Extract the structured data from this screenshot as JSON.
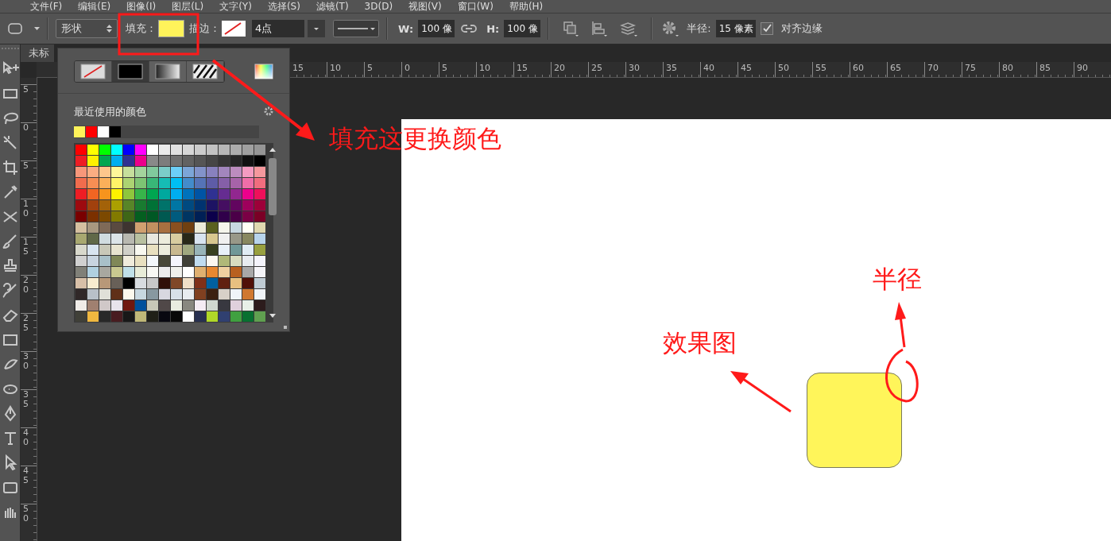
{
  "menu": [
    "文件(F)",
    "编辑(E)",
    "图像(I)",
    "图层(L)",
    "文字(Y)",
    "选择(S)",
    "滤镜(T)",
    "3D(D)",
    "视图(V)",
    "窗口(W)",
    "帮助(H)"
  ],
  "options_bar": {
    "mode": "形状",
    "fill_label": "填充：",
    "fill": {
      "color": "#fff35a"
    },
    "stroke_label": "描边：",
    "stroke_width": "4点",
    "w_label": "W:",
    "w_value": "100 像",
    "h_label": "H:",
    "h_value": "100 像",
    "radius_label": "半径:",
    "radius_value": "15 像素",
    "align_edges": {
      "label": "对齐边缘",
      "checked": true
    }
  },
  "document_tab": "未标",
  "ruler": {
    "h_labels": [
      "15",
      "10",
      "5",
      "0",
      "5",
      "10",
      "15",
      "20",
      "25",
      "30",
      "35",
      "40",
      "45",
      "50",
      "55",
      "60",
      "65",
      "70",
      "75",
      "80",
      "85",
      "90"
    ],
    "v_labels": [
      "5",
      "0",
      "5",
      "10",
      "15",
      "20",
      "25",
      "30",
      "35",
      "40",
      "45",
      "50"
    ]
  },
  "fill_popover": {
    "types": [
      {
        "kind": "none",
        "selected": false
      },
      {
        "kind": "solid",
        "selected": true
      },
      {
        "kind": "gradient",
        "selected": false
      },
      {
        "kind": "pattern",
        "selected": false
      }
    ],
    "recent_label": "最近使用的颜色",
    "recent_colors": [
      {
        "color": "#fff35a"
      },
      {
        "color": "#ff0000"
      },
      {
        "color": "#ffffff"
      },
      {
        "color": "#000000"
      }
    ],
    "swatch_rows": [
      [
        {
          "color": "#ff0000"
        },
        {
          "color": "#ffff00"
        },
        {
          "color": "#00ff00"
        },
        {
          "color": "#00ffff"
        },
        {
          "color": "#0000ff"
        },
        {
          "color": "#ff00ff"
        },
        {
          "color": "#ffffff"
        },
        {
          "color": "#ebebeb"
        },
        {
          "color": "#e1e1e1"
        },
        {
          "color": "#d7d7d7"
        },
        {
          "color": "#cccccc"
        },
        {
          "color": "#c2c2c2"
        },
        {
          "color": "#b7b7b7"
        },
        {
          "color": "#acacac"
        },
        {
          "color": "#a0a0a0"
        },
        {
          "color": "#959595"
        }
      ],
      [
        {
          "color": "#ee1d24"
        },
        {
          "color": "#fff100"
        },
        {
          "color": "#00a650"
        },
        {
          "color": "#00aeef"
        },
        {
          "color": "#2f3192"
        },
        {
          "color": "#ed008c"
        },
        {
          "color": "#898989"
        },
        {
          "color": "#7d7d7d"
        },
        {
          "color": "#707070"
        },
        {
          "color": "#626262"
        },
        {
          "color": "#555555"
        },
        {
          "color": "#464646"
        },
        {
          "color": "#363636"
        },
        {
          "color": "#262626"
        },
        {
          "color": "#111111"
        },
        {
          "color": "#000000"
        }
      ],
      [
        {
          "color": "#f7977a"
        },
        {
          "color": "#fbad82"
        },
        {
          "color": "#fdc68c"
        },
        {
          "color": "#fff799"
        },
        {
          "color": "#c6df9c"
        },
        {
          "color": "#a4d49d"
        },
        {
          "color": "#81ca9d"
        },
        {
          "color": "#7bcdc9"
        },
        {
          "color": "#6ccff7"
        },
        {
          "color": "#7ca6d8"
        },
        {
          "color": "#8293ca"
        },
        {
          "color": "#8881be"
        },
        {
          "color": "#a286bd"
        },
        {
          "color": "#bc8cbf"
        },
        {
          "color": "#f49bc1"
        },
        {
          "color": "#f5989d"
        }
      ],
      [
        {
          "color": "#f16c4d"
        },
        {
          "color": "#f68e54"
        },
        {
          "color": "#fbaf5a"
        },
        {
          "color": "#fff467"
        },
        {
          "color": "#acd372"
        },
        {
          "color": "#7dc473"
        },
        {
          "color": "#39b778"
        },
        {
          "color": "#16bcb4"
        },
        {
          "color": "#00bff3"
        },
        {
          "color": "#438ccb"
        },
        {
          "color": "#5573b7"
        },
        {
          "color": "#5e5ca7"
        },
        {
          "color": "#855fa8"
        },
        {
          "color": "#a763a9"
        },
        {
          "color": "#ef6ea8"
        },
        {
          "color": "#f16d7e"
        }
      ],
      [
        {
          "color": "#ee1d24"
        },
        {
          "color": "#f16522"
        },
        {
          "color": "#f7941d"
        },
        {
          "color": "#fff100"
        },
        {
          "color": "#8fc63d"
        },
        {
          "color": "#37b44a"
        },
        {
          "color": "#00a650"
        },
        {
          "color": "#00a99e"
        },
        {
          "color": "#00aeef"
        },
        {
          "color": "#0072bc"
        },
        {
          "color": "#0054a5"
        },
        {
          "color": "#2f3192"
        },
        {
          "color": "#652c91"
        },
        {
          "color": "#91278f"
        },
        {
          "color": "#ed008c"
        },
        {
          "color": "#ee105a"
        }
      ],
      [
        {
          "color": "#9d0a0f"
        },
        {
          "color": "#a1410d"
        },
        {
          "color": "#a36209"
        },
        {
          "color": "#aba000"
        },
        {
          "color": "#588528"
        },
        {
          "color": "#197b30"
        },
        {
          "color": "#007236"
        },
        {
          "color": "#00736a"
        },
        {
          "color": "#0076a4"
        },
        {
          "color": "#004a80"
        },
        {
          "color": "#003370"
        },
        {
          "color": "#1d1363"
        },
        {
          "color": "#450e61"
        },
        {
          "color": "#62055f"
        },
        {
          "color": "#9e005c"
        },
        {
          "color": "#9d0039"
        }
      ],
      [
        {
          "color": "#790000"
        },
        {
          "color": "#7b3000"
        },
        {
          "color": "#7c4900"
        },
        {
          "color": "#827a00"
        },
        {
          "color": "#3e6617"
        },
        {
          "color": "#045f20"
        },
        {
          "color": "#005824"
        },
        {
          "color": "#005951"
        },
        {
          "color": "#005b7e"
        },
        {
          "color": "#003562"
        },
        {
          "color": "#002056"
        },
        {
          "color": "#0c004b"
        },
        {
          "color": "#30004a"
        },
        {
          "color": "#4b0048"
        },
        {
          "color": "#7a0045"
        },
        {
          "color": "#7a0026"
        }
      ],
      [
        {
          "color": "#d5c0a0"
        },
        {
          "color": "#a89880"
        },
        {
          "color": "#7f6a58"
        },
        {
          "color": "#5a4a40"
        },
        {
          "color": "#3e3430"
        },
        {
          "color": "#d0a070"
        },
        {
          "color": "#c09060"
        },
        {
          "color": "#a87040"
        },
        {
          "color": "#8a5020"
        },
        {
          "color": "#704010"
        },
        {
          "color": "#ecebd8"
        },
        {
          "color": "#5a6020"
        },
        {
          "color": "#f5f5ec"
        },
        {
          "color": "#c8d8e0"
        },
        {
          "color": "#fffff5"
        },
        {
          "color": "#e0d8b0"
        }
      ],
      [
        {
          "color": "#a8a870"
        },
        {
          "color": "#606848"
        },
        {
          "color": "#d0dce0"
        },
        {
          "color": "#dce4e8"
        },
        {
          "color": "#b8b8b0"
        },
        {
          "color": "#b8c0a0"
        },
        {
          "color": "#e8e8e0"
        },
        {
          "color": "#ececdc"
        },
        {
          "color": "#d8cca0"
        },
        {
          "color": "#282818"
        },
        {
          "color": "#d8e4f0"
        },
        {
          "color": "#d8c890"
        },
        {
          "color": "#f0f0f0"
        },
        {
          "color": "#989888"
        },
        {
          "color": "#888860"
        },
        {
          "color": "#b8d4ec"
        }
      ],
      [
        {
          "color": "#d8d8cc"
        },
        {
          "color": "#d8e4f0"
        },
        {
          "color": "#c8c8b8"
        },
        {
          "color": "#e8e4d0"
        },
        {
          "color": "#d0d0c8"
        },
        {
          "color": "#f8f8f0"
        },
        {
          "color": "#e8e0c0"
        },
        {
          "color": "#ececdc"
        },
        {
          "color": "#c8b890"
        },
        {
          "color": "#a0a880"
        },
        {
          "color": "#98b4b8"
        },
        {
          "color": "#384020"
        },
        {
          "color": "#e8f0f8"
        },
        {
          "color": "#709898"
        },
        {
          "color": "#e0ecf4"
        },
        {
          "color": "#98a040"
        }
      ],
      [
        {
          "color": "#d0d0d0"
        },
        {
          "color": "#c8d4e0"
        },
        {
          "color": "#a8c0c8"
        },
        {
          "color": "#808858"
        },
        {
          "color": "#f0ecdc"
        },
        {
          "color": "#e8e0c0"
        },
        {
          "color": "#f4f8fc"
        },
        {
          "color": "#484838"
        },
        {
          "color": "#f4f4fc"
        },
        {
          "color": "#404038"
        },
        {
          "color": "#c0dcf0"
        },
        {
          "color": "#fcf8f0"
        },
        {
          "color": "#b0b878"
        },
        {
          "color": "#d8dcc0"
        },
        {
          "color": "#e8ecf0"
        },
        {
          "color": "#f4f4fc"
        }
      ],
      [
        {
          "color": "#808078"
        },
        {
          "color": "#b0d0e0"
        },
        {
          "color": "#a8a8a0"
        },
        {
          "color": "#c8c890"
        },
        {
          "color": "#c0e0e8"
        },
        {
          "color": "#e8ecd8"
        },
        {
          "color": "#f8f8f4"
        },
        {
          "color": "#ececec"
        },
        {
          "color": "#f0f0ec"
        },
        {
          "color": "#ffffff"
        },
        {
          "color": "#e0b070"
        },
        {
          "color": "#e88830"
        },
        {
          "color": "#f0d0a0"
        },
        {
          "color": "#b86020"
        },
        {
          "color": "#a8a8a8"
        },
        {
          "color": "#f4f4f8"
        }
      ],
      [
        {
          "color": "#d8c0a8"
        },
        {
          "color": "#f8ecd0"
        },
        {
          "color": "#b89878"
        },
        {
          "color": "#686058"
        },
        {
          "color": "#000000"
        },
        {
          "color": "#d8dce0"
        },
        {
          "color": "#c8c8c8"
        },
        {
          "color": "#301008"
        },
        {
          "color": "#804828"
        },
        {
          "color": "#f0e0c8"
        },
        {
          "color": "#803018"
        },
        {
          "color": "#0060a0"
        },
        {
          "color": "#602010"
        },
        {
          "color": "#e8c080"
        },
        {
          "color": "#501008"
        },
        {
          "color": "#c0ccd4"
        }
      ],
      [
        {
          "color": "#302828"
        },
        {
          "color": "#b8c0c8"
        },
        {
          "color": "#e0e0d8"
        },
        {
          "color": "#603018"
        },
        {
          "color": "#fcf8ec"
        },
        {
          "color": "#c8d8e0"
        },
        {
          "color": "#8898a0"
        },
        {
          "color": "#d8d8e0"
        },
        {
          "color": "#d8e0e8"
        },
        {
          "color": "#e8ecf0"
        },
        {
          "color": "#804020"
        },
        {
          "color": "#3c2010"
        },
        {
          "color": "#d8d0c8"
        },
        {
          "color": "#f0f4f8"
        },
        {
          "color": "#d07830"
        },
        {
          "color": "#f0f4f8"
        }
      ],
      [
        {
          "color": "#f0ece8"
        },
        {
          "color": "#a08070"
        },
        {
          "color": "#d0c8c8"
        },
        {
          "color": "#e8e4ec"
        },
        {
          "color": "#701810"
        },
        {
          "color": "#00509c"
        },
        {
          "color": "#c8c8b8"
        },
        {
          "color": "#504848"
        },
        {
          "color": "#e8ece0"
        },
        {
          "color": "#888880"
        },
        {
          "color": "#f4ecf4"
        },
        {
          "color": "#d0d8d0"
        },
        {
          "color": "#383840"
        },
        {
          "color": "#e0d0dc"
        },
        {
          "color": "#e8f0e8"
        },
        {
          "color": "#2c1c1c"
        }
      ],
      [
        {
          "color": "#404038"
        },
        {
          "color": "#f0b840"
        },
        {
          "color": "#282828"
        },
        {
          "color": "#481c20"
        },
        {
          "color": "#181818"
        },
        {
          "color": "#c0b878"
        },
        {
          "color": "#202018"
        },
        {
          "color": "#080810"
        },
        {
          "color": "#080808"
        },
        {
          "color": "#ffffff"
        },
        {
          "color": "#283050"
        },
        {
          "color": "#b0d828"
        },
        {
          "color": "#304070"
        },
        {
          "color": "#40a040"
        },
        {
          "color": "#087030"
        },
        {
          "color": "#60a050"
        }
      ]
    ]
  },
  "canvas": {
    "shape": {
      "color": "#fff55a"
    }
  },
  "annotations": [
    {
      "text": "填充这更换颜色"
    },
    {
      "text": "半径"
    },
    {
      "text": "效果图"
    }
  ]
}
